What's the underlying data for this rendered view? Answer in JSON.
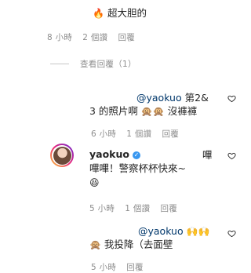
{
  "comments": [
    {
      "text": "超大胆的",
      "emoji": "🔥",
      "time": "8 小時",
      "likes": "2 個讚",
      "reply": "回覆",
      "view_replies": "查看回覆（1）"
    },
    {
      "mention": "@yaokuo",
      "text_line1": " 第2&",
      "text_line2": "3 的照片啊",
      "emojis": "🙊🙊",
      "text_after": " 沒褲褲",
      "time": "6 小時",
      "likes": "1 個讚",
      "reply": "回覆"
    },
    {
      "username": "yaokuo",
      "verified_mark": "✓",
      "text_line1": "嗶",
      "text_line2": "嗶嗶！警察杯杯快來~",
      "emoji": "😆",
      "time": "5 小時",
      "likes": "1 個讚",
      "reply": "回覆"
    },
    {
      "mention": "@yaokuo",
      "emojis_top": "🙌🙌",
      "emoji": "🙊",
      "text": " 我投降（去面壁",
      "time": "5 小時",
      "reply": "回覆"
    }
  ],
  "icons": {
    "heart": "heart-outline-icon"
  },
  "colors": {
    "meta_text": "#8e8e8e",
    "mention": "#00376b",
    "verified": "#3897f0"
  }
}
